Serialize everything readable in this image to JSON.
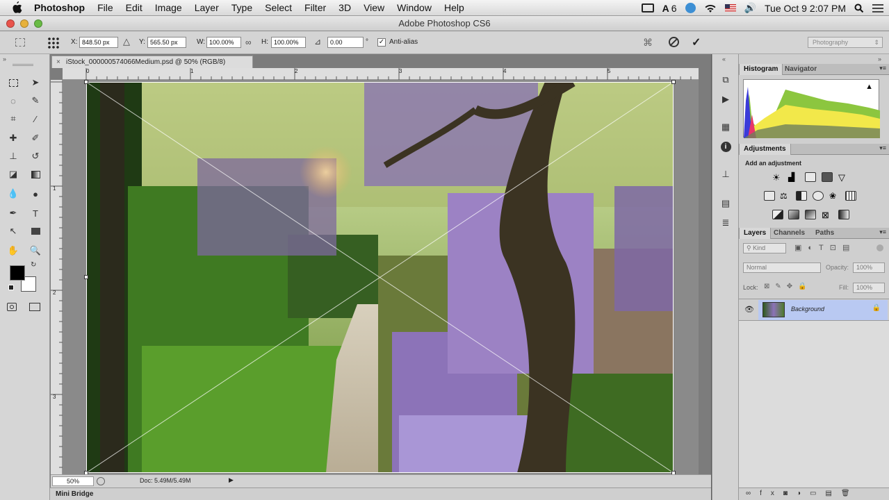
{
  "menubar": {
    "app_name": "Photoshop",
    "items": [
      "File",
      "Edit",
      "Image",
      "Layer",
      "Type",
      "Select",
      "Filter",
      "3D",
      "View",
      "Window",
      "Help"
    ],
    "adobe_badge": "6",
    "clock": "Tue Oct 9  2:07 PM"
  },
  "window": {
    "title": "Adobe Photoshop CS6"
  },
  "options": {
    "x_label": "X:",
    "x_value": "848.50 px",
    "y_label": "Y:",
    "y_value": "565.50 px",
    "w_label": "W:",
    "w_value": "100.00%",
    "h_label": "H:",
    "h_value": "100.00%",
    "angle_value": "0.00",
    "angle_unit": "°",
    "antialias_label": "Anti-alias",
    "workspace": "Photography"
  },
  "document": {
    "tab_title": "iStock_000000574066Medium.psd @ 50% (RGB/8)",
    "zoom": "50%",
    "doc_size": "Doc: 5.49M/5.49M",
    "hruler_labels": [
      "0",
      "1",
      "2",
      "3",
      "4",
      "5"
    ],
    "vruler_labels": [
      "1",
      "2",
      "3"
    ]
  },
  "minibridge": {
    "label": "Mini Bridge"
  },
  "histogram_panel": {
    "tabs": [
      "Histogram",
      "Navigator"
    ]
  },
  "adjustments_panel": {
    "tab": "Adjustments",
    "title": "Add an adjustment"
  },
  "layers_panel": {
    "tabs": [
      "Layers",
      "Channels",
      "Paths"
    ],
    "filter_kind": "Kind",
    "blend_mode": "Normal",
    "opacity_label": "Opacity:",
    "opacity_value": "100%",
    "lock_label": "Lock:",
    "fill_label": "Fill:",
    "fill_value": "100%",
    "layers": [
      {
        "name": "Background",
        "locked": true,
        "visible": true
      }
    ]
  },
  "colors": {
    "foreground": "#000000",
    "background": "#ffffff",
    "layer_selected": "#b9c9f2"
  }
}
